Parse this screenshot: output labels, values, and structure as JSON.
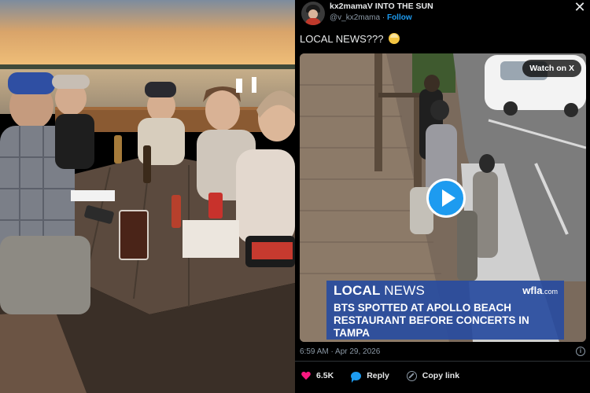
{
  "post": {
    "author_name": "kx2mamaV INTO THE SUN",
    "author_handle": "@v_kx2mama",
    "separator": "·",
    "follow_label": "Follow",
    "close_icon": "close-icon",
    "text": "LOCAL NEWS???",
    "text_emoji": "exploding-head-emoji",
    "timestamp": "6:59 AM · Apr 29, 2026",
    "info_icon": "info-icon"
  },
  "video": {
    "watch_label": "Watch on X",
    "play_icon": "play-icon",
    "lower_third": {
      "section_bold": "LOCAL",
      "section_light": "NEWS",
      "brand": "wfla",
      "brand_suffix": ".com",
      "headline": "BTS SPOTTED AT APOLLO BEACH RESTAURANT BEFORE CONCERTS IN TAMPA"
    }
  },
  "actions": {
    "likes_count": "6.5K",
    "like_icon": "heart-icon",
    "reply_label": "Reply",
    "reply_icon": "reply-bubble-icon",
    "copy_label": "Copy link",
    "copy_icon": "link-icon"
  },
  "colors": {
    "accent": "#1d9bf0",
    "like": "#f91880",
    "background": "#000000",
    "news_banner": "#284ca0"
  }
}
